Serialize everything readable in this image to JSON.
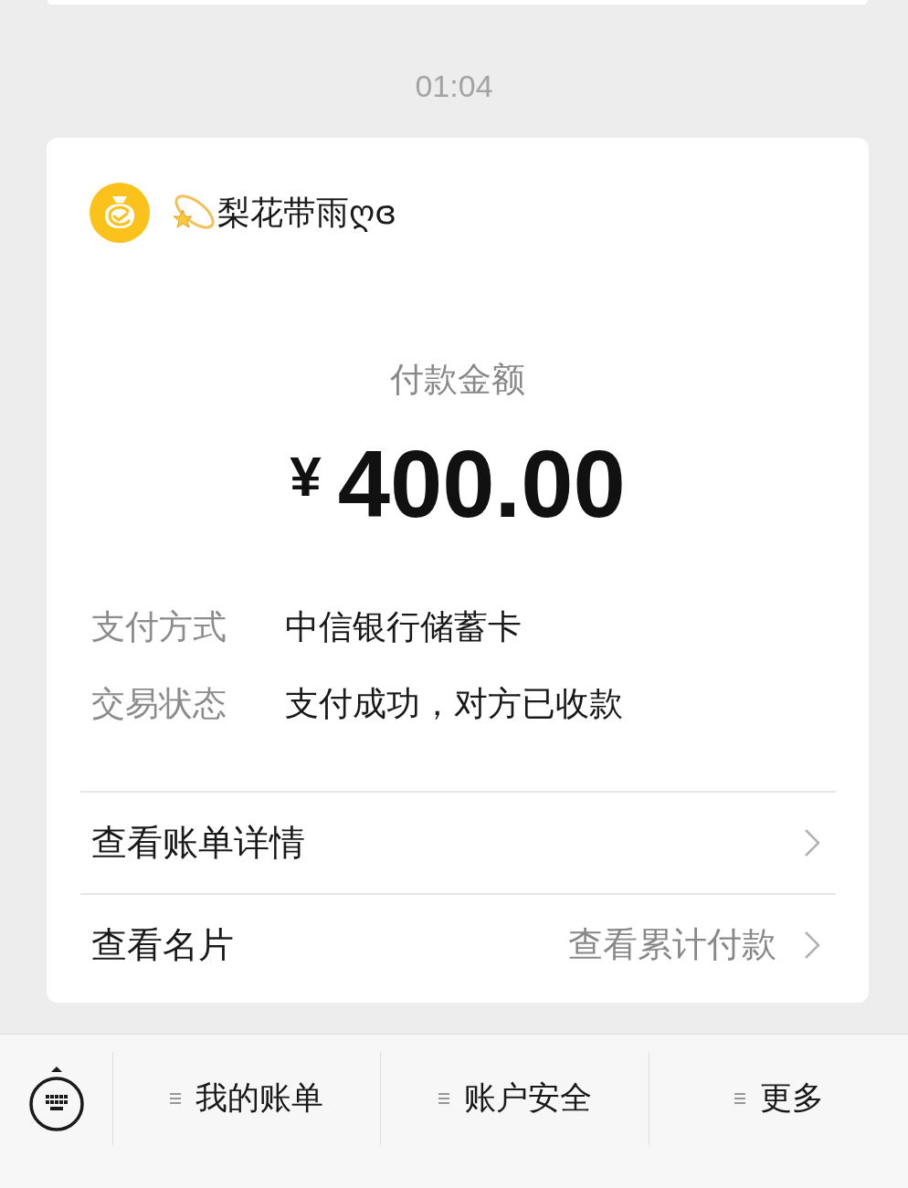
{
  "time": "01:04",
  "payment_card": {
    "merchant": {
      "name": "梨花带雨ღɞ"
    },
    "amount_label": "付款金额",
    "currency": "¥",
    "amount": "400.00",
    "details": [
      {
        "label": "支付方式",
        "value": "中信银行储蓄卡"
      },
      {
        "label": "交易状态",
        "value": "支付成功，对方已收款"
      }
    ],
    "links": [
      {
        "label": "查看账单详情"
      },
      {
        "label": "查看名片",
        "hint": "查看累计付款"
      }
    ]
  },
  "bottom_menu": {
    "items": [
      {
        "label": "我的账单"
      },
      {
        "label": "账户安全"
      },
      {
        "label": "更多"
      }
    ]
  }
}
